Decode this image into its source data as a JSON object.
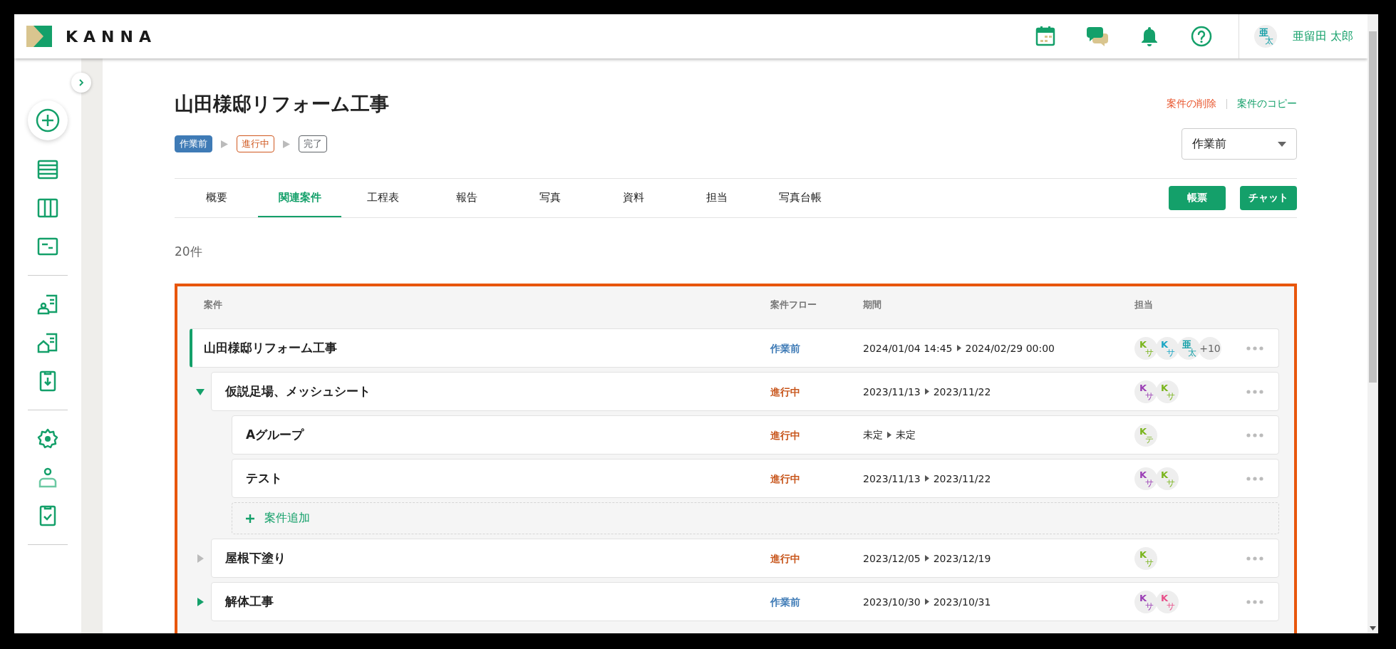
{
  "header": {
    "logo_text": "KANNA",
    "user": {
      "avatar_top": "亜",
      "avatar_bottom": "太",
      "name": "亜留田 太郎"
    }
  },
  "project": {
    "title": "山田様邸リフォーム工事",
    "steps": [
      {
        "label": "作業前",
        "color": "#3f7bb6",
        "current": true
      },
      {
        "label": "進行中",
        "color": "#d0581f",
        "current": false
      },
      {
        "label": "完了",
        "color": "#5f6368",
        "current": false
      }
    ],
    "actions": [
      {
        "label": "案件の削除",
        "color": "#e8532a"
      },
      {
        "label": "案件のコピー",
        "color": "#14a06a"
      }
    ],
    "status_select": {
      "value": "作業前"
    }
  },
  "tabs": [
    {
      "label": "概要",
      "selected": false
    },
    {
      "label": "関連案件",
      "selected": true
    },
    {
      "label": "工程表",
      "selected": false
    },
    {
      "label": "報告",
      "selected": false
    },
    {
      "label": "写真",
      "selected": false
    },
    {
      "label": "資料",
      "selected": false
    },
    {
      "label": "担当",
      "selected": false
    },
    {
      "label": "写真台帳",
      "selected": false
    }
  ],
  "tab_buttons": [
    "帳票",
    "チャット"
  ],
  "count": "20件",
  "table": {
    "columns": [
      "案件",
      "案件フロー",
      "期間",
      "担当"
    ],
    "rows": [
      {
        "name": "山田様邸リフォーム工事",
        "current": true,
        "flow": {
          "label": "作業前",
          "color": "#3f7bb6"
        },
        "period": {
          "start": "2024/01/04 14:45",
          "end": "2024/02/29 00:00"
        },
        "assignees": [
          {
            "top": "K",
            "bottom": "サ",
            "color": "#7ab51d"
          },
          {
            "top": "K",
            "bottom": "サ",
            "color": "#1ca6c4"
          },
          {
            "top": "亜",
            "bottom": "太",
            "color": "#14a0a8"
          }
        ],
        "more": "+10",
        "children": [
          {
            "name": "仮説足場、メッシュシート",
            "current": false,
            "expanded": true,
            "has_children": true,
            "flow": {
              "label": "進行中",
              "color": "#c8561c"
            },
            "period": {
              "start": "2023/11/13",
              "end": "2023/11/22"
            },
            "assignees": [
              {
                "top": "K",
                "bottom": "サ",
                "color": "#9b3fb5"
              },
              {
                "top": "K",
                "bottom": "サ",
                "color": "#7ab51d"
              }
            ],
            "children": [
              {
                "name": "Aグループ",
                "current": false,
                "flow": {
                  "label": "進行中",
                  "color": "#c8561c"
                },
                "period": {
                  "start": "未定",
                  "end": "未定"
                },
                "assignees": [
                  {
                    "top": "K",
                    "bottom": "テ",
                    "color": "#7ab51d"
                  }
                ]
              },
              {
                "name": "テスト",
                "current": false,
                "flow": {
                  "label": "進行中",
                  "color": "#c8561c"
                },
                "period": {
                  "start": "2023/11/13",
                  "end": "2023/11/22"
                },
                "assignees": [
                  {
                    "top": "K",
                    "bottom": "サ",
                    "color": "#9b3fb5"
                  },
                  {
                    "top": "K",
                    "bottom": "サ",
                    "color": "#7ab51d"
                  }
                ]
              }
            ],
            "add_button": "案件追加"
          },
          {
            "name": "屋根下塗り",
            "current": false,
            "expanded": false,
            "has_children": false,
            "flow": {
              "label": "進行中",
              "color": "#c8561c"
            },
            "period": {
              "start": "2023/12/05",
              "end": "2023/12/19"
            },
            "assignees": [
              {
                "top": "K",
                "bottom": "サ",
                "color": "#7ab51d"
              }
            ]
          },
          {
            "name": "解体工事",
            "current": false,
            "expanded": false,
            "has_children": true,
            "flow": {
              "label": "作業前",
              "color": "#3f7bb6"
            },
            "period": {
              "start": "2023/10/30",
              "end": "2023/10/31"
            },
            "assignees": [
              {
                "top": "K",
                "bottom": "サ",
                "color": "#9b3fb5"
              },
              {
                "top": "K",
                "bottom": "サ",
                "color": "#e8508a"
              }
            ]
          }
        ]
      }
    ]
  }
}
